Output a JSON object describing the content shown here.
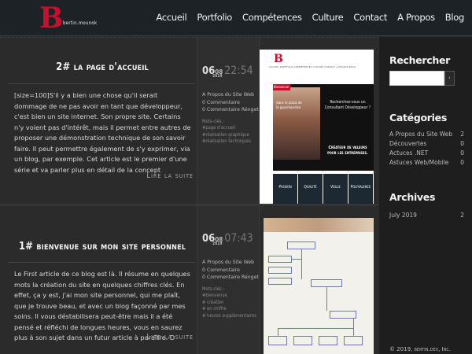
{
  "header": {
    "logo_letter": "B",
    "logo_text": "bertin.mounok",
    "nav": [
      "Accueil",
      "Portfolio",
      "Compétences",
      "Culture",
      "Contact",
      "A Propos",
      "Blog"
    ]
  },
  "posts": [
    {
      "title": "2# la page d'accueil",
      "body": "[size=100]S'il y a bien une chose qu'il serait dommage de ne pas avoir en tant que développeur, c'est bien un site internet. Son propre site. Certains n'y voient pas d'intérêt, mais il permet entre autres de proposer une démonstration technique de son savoir faire. Il peut permettre également de s'y exprimer, via un blog, par exemple. Cet article est le premier d'une série et va parler plus en détail de la concept",
      "read_more": "Lire la suite",
      "day": "06",
      "month": "08",
      "year": "2019",
      "time": "22:54",
      "meta": [
        "A Propos du Site Web",
        "0 Commentaire",
        "0 Commentaire Rénget"
      ],
      "tags": [
        "Mots-clés :",
        "#page d'accueil",
        "#réalisation graphique",
        "#réalisation techniques"
      ]
    },
    {
      "title": "1# bienvenue sur mon site personnel",
      "body": "Le First article de ce blog est là. Il résume en quelques mots la création du site en quelques chiffres clés. En effet, ça y est, j'ai mon site personnel, qui me plaît, que je trouve beau, et avec un blog façonné par mes soins. Il vous déstabilisera peut-être mais il a été pensé et réfléchi de longues heures, vous en saurez plus à son sujet dans un futur article à paraître. D",
      "read_more": "Lire la suite",
      "day": "06",
      "month": "08",
      "year": "2019",
      "time": "07:43",
      "meta": [
        "A Propos du Site Web",
        "0 Commentaire",
        "0 Commentaire Rénget"
      ],
      "tags": [
        "Mots-clés :",
        "#bienvenue",
        "# création",
        "# en chiffre",
        "# heures supplémentaires"
      ]
    }
  ],
  "mini_site": {
    "logo_letter": "B",
    "nav": "ACCUEIL  PORTFOLIO  COMPÉTENCES  CULTURE  CONTACT  À PROPOS  BLOG",
    "badge": "Bienvenue",
    "overlay": "dans le pizza de\nla gourmandise",
    "tagline": "Recherchez-vous un Consultant Développeur ?",
    "headline": "Créateur de valeurs pour les entreprises.",
    "tabs": [
      "Passion",
      "Qualité",
      "Veille",
      "Polyvalence"
    ]
  },
  "sidebar": {
    "search_heading": "Rechercher",
    "search_value": "",
    "search_button": "›",
    "categories_heading": "Catégories",
    "categories": [
      {
        "name": "A Propos du Site Web",
        "count": "2"
      },
      {
        "name": "Découvertes",
        "count": "0"
      },
      {
        "name": "Actuces .NET",
        "count": "0"
      },
      {
        "name": "Astuces Web/Mobile",
        "count": "0"
      }
    ],
    "archives_heading": "Archives",
    "archives": [
      {
        "name": "July 2019",
        "count": "2"
      }
    ],
    "copyright": "© 2019, bertin.dev, Inc."
  },
  "colors": {
    "accent": "#c8102e",
    "header_bg": "#1d2226",
    "content_bg": "#2b2b2b",
    "sidebar_bg": "#1e1e1e"
  }
}
